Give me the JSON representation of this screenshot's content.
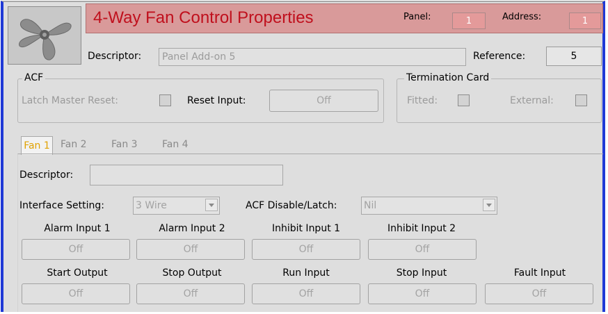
{
  "header": {
    "title": "4-Way Fan Control Properties",
    "panel_label": "Panel:",
    "panel_value": "1",
    "address_label": "Address:",
    "address_value": "1",
    "descriptor_label": "Descriptor:",
    "descriptor_value": "Panel Add-on 5",
    "reference_label": "Reference:",
    "reference_value": "5"
  },
  "acf": {
    "title": "ACF",
    "latch_master_reset_label": "Latch Master Reset:",
    "reset_input_label": "Reset Input:",
    "reset_input_value": "Off"
  },
  "termination_card": {
    "title": "Termination Card",
    "fitted_label": "Fitted:",
    "external_label": "External:"
  },
  "tabs": [
    {
      "label": "Fan 1",
      "active": true
    },
    {
      "label": "Fan 2",
      "active": false
    },
    {
      "label": "Fan 3",
      "active": false
    },
    {
      "label": "Fan 4",
      "active": false
    }
  ],
  "fan": {
    "descriptor_label": "Descriptor:",
    "descriptor_value": "",
    "interface_setting_label": "Interface Setting:",
    "interface_setting_value": "3 Wire",
    "acf_disable_label": "ACF Disable/Latch:",
    "acf_disable_value": "Nil",
    "inputs_row1": [
      {
        "label": "Alarm Input 1",
        "value": "Off"
      },
      {
        "label": "Alarm Input 2",
        "value": "Off"
      },
      {
        "label": "Inhibit Input 1",
        "value": "Off"
      },
      {
        "label": "Inhibit Input 2",
        "value": "Off"
      }
    ],
    "inputs_row2": [
      {
        "label": "Start Output",
        "value": "Off"
      },
      {
        "label": "Stop Output",
        "value": "Off"
      },
      {
        "label": "Run Input",
        "value": "Off"
      },
      {
        "label": "Stop Input",
        "value": "Off"
      },
      {
        "label": "Fault Input",
        "value": "Off"
      }
    ]
  },
  "colors": {
    "frame_border": "#1f39d6",
    "title_bar": "#d99a9a",
    "title_text": "#c0101d",
    "active_tab_text": "#e0a100"
  }
}
